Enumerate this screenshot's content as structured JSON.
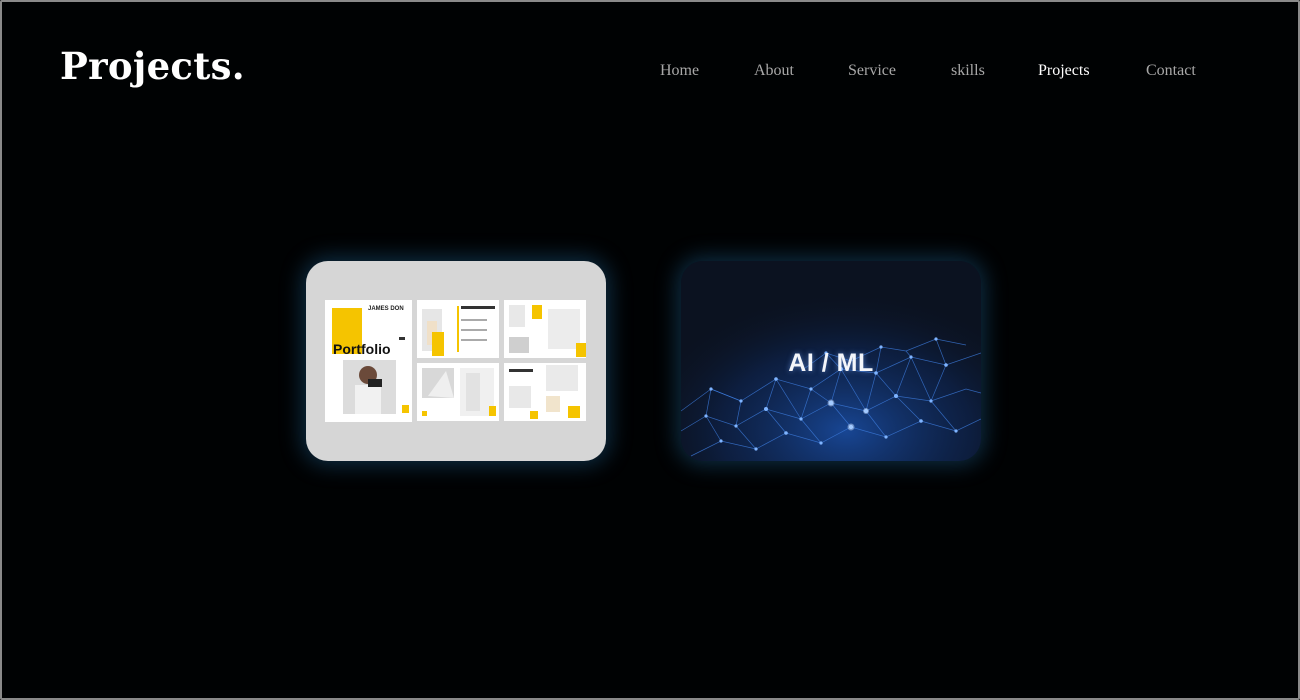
{
  "header": {
    "logo": "Projects.",
    "nav": [
      "Home",
      "About",
      "Service",
      "skills",
      "Projects",
      "Contact"
    ],
    "active_nav": "Projects"
  },
  "projects": [
    {
      "name": "portfolio",
      "thumbnail_title": "Portfolio",
      "thumbnail_subtitle": "JAMES DON",
      "thumbnail_icon": "portfolio-mockup"
    },
    {
      "name": "ai-ml",
      "thumbnail_title": "AI / ML",
      "thumbnail_icon": "neural-network"
    }
  ],
  "colors": {
    "background": "#000203",
    "nav_text": "#a8a8a8",
    "nav_active": "#ffffff",
    "card_glow": "#2882be",
    "portfolio_accent": "#f5c400",
    "network_blue": "#3d7de0"
  }
}
